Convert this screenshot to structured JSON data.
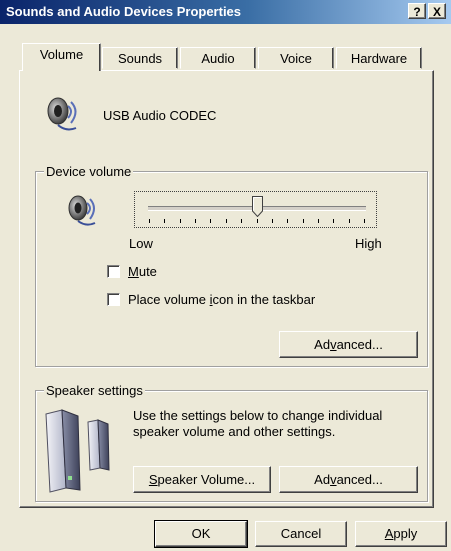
{
  "window": {
    "title": "Sounds and Audio Devices Properties",
    "help_button": "?",
    "close_button": "X"
  },
  "tabs": [
    {
      "label": "Volume"
    },
    {
      "label": "Sounds"
    },
    {
      "label": "Audio"
    },
    {
      "label": "Voice"
    },
    {
      "label": "Hardware"
    }
  ],
  "device": {
    "name": "USB Audio CODEC"
  },
  "device_volume": {
    "group_label": "Device volume",
    "low_label": "Low",
    "high_label": "High",
    "level": 0.5,
    "mute": {
      "label_pre": "",
      "label_mnemonic": "M",
      "label_post": "ute",
      "checked": false
    },
    "taskbar": {
      "label_pre": "Place volume ",
      "label_mnemonic": "i",
      "label_post": "con in the taskbar",
      "checked": false
    },
    "advanced": {
      "pre": "Ad",
      "mnemonic": "v",
      "post": "anced..."
    }
  },
  "speaker_settings": {
    "group_label": "Speaker settings",
    "description": "Use the settings below to change individual speaker volume and other settings.",
    "speaker_volume": {
      "pre": "",
      "mnemonic": "S",
      "post": "peaker Volume..."
    },
    "advanced": {
      "pre": "Ad",
      "mnemonic": "v",
      "post": "anced..."
    }
  },
  "footer": {
    "ok": "OK",
    "cancel": "Cancel",
    "apply": {
      "pre": "",
      "mnemonic": "A",
      "post": "pply"
    }
  }
}
